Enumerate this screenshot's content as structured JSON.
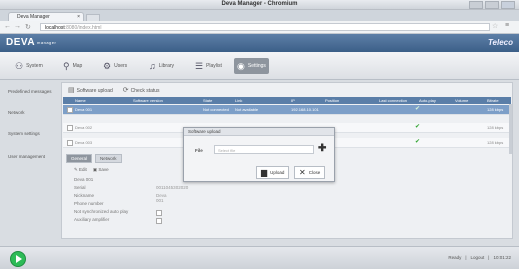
{
  "window": {
    "title": "Deva Manager - Chromium"
  },
  "browser": {
    "tab_label": "Deva Manager",
    "tab_close": "×",
    "url_host": "localhost",
    "url_rest": ":8080/index.html"
  },
  "app": {
    "logo": "DEVA",
    "logo_sub": "manager",
    "brand": "Teleco"
  },
  "toolbar": {
    "items": [
      {
        "label": "System",
        "icon": "users-icon"
      },
      {
        "label": "Map",
        "icon": "location-icon"
      },
      {
        "label": "Users",
        "icon": "gear-icon"
      },
      {
        "label": "Library",
        "icon": "music-icon"
      },
      {
        "label": "Playlist",
        "icon": "playlist-icon"
      },
      {
        "label": "Settings",
        "icon": "settings-icon"
      }
    ]
  },
  "leftnav": {
    "items": [
      "Predefined messages",
      "Network",
      "System settings",
      "User management"
    ]
  },
  "table": {
    "toolbar": {
      "upload": "Software upload",
      "check": "Check status"
    },
    "columns": [
      "Name",
      "Software version",
      "State",
      "Link",
      "IP",
      "Position",
      "Last connection",
      "Auto-play",
      "Volume",
      "Bitrate"
    ],
    "rows": [
      {
        "name": "Deva 001",
        "state": "Not connected",
        "link": "Not available",
        "ip": "192.168.10.101",
        "ok": "✔",
        "bitrate": "128 kbps",
        "selected": true
      },
      {
        "name": "Deva 002",
        "ok": "✔",
        "bitrate": "128 kbps",
        "selected": false
      },
      {
        "name": "Deva 003",
        "ok": "✔",
        "bitrate": "128 kbps",
        "selected": false
      }
    ]
  },
  "detail": {
    "tabs": [
      "General",
      "Network"
    ],
    "toolbar": {
      "edit": "Edit",
      "save": "Save"
    },
    "name_title": "Deva 001",
    "fields": [
      {
        "label": "Serial",
        "value": "0011045302020"
      },
      {
        "label": "Nickname",
        "value": "Deva 001"
      },
      {
        "label": "Phone number",
        "value": ""
      },
      {
        "label": "Not synchronized auto play",
        "value": ""
      },
      {
        "label": "Auxiliary amplifier",
        "value": ""
      }
    ]
  },
  "dialog": {
    "title": "Software upload",
    "file_label": "File",
    "file_placeholder": "Select file",
    "upload": "Upload",
    "close": "Close"
  },
  "status": {
    "ready": "Ready",
    "logout": "Logout",
    "time": "10:01:22"
  }
}
